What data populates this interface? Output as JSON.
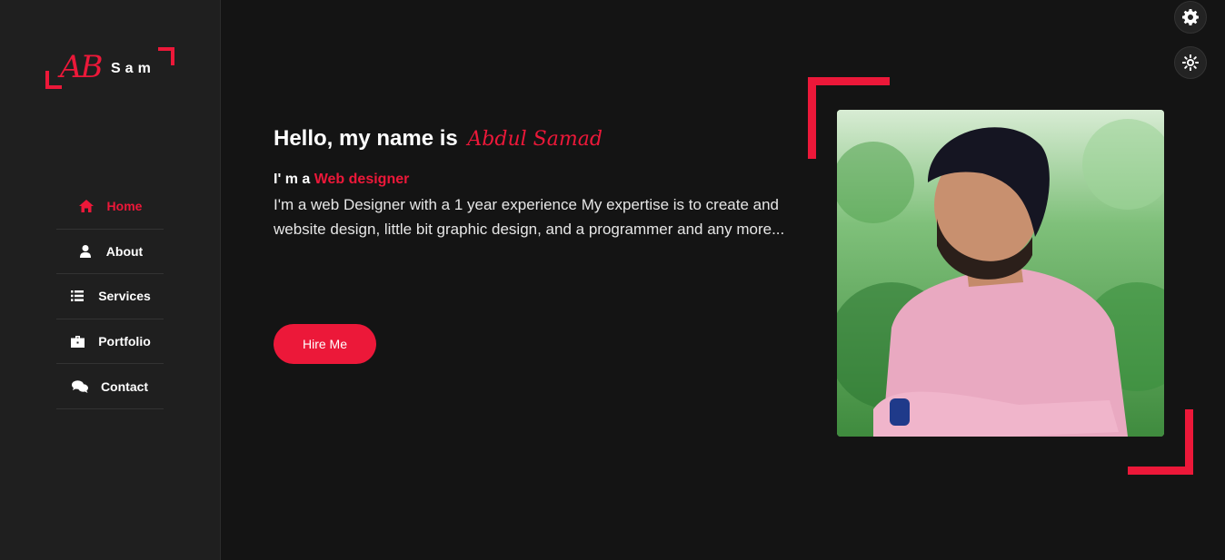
{
  "logo": {
    "mark": "AB",
    "name": "Sam"
  },
  "nav": {
    "items": [
      {
        "label": "Home",
        "icon": "home-icon",
        "active": true
      },
      {
        "label": "About",
        "icon": "user-icon",
        "active": false
      },
      {
        "label": "Services",
        "icon": "list-icon",
        "active": false
      },
      {
        "label": "Portfolio",
        "icon": "briefcase-icon",
        "active": false
      },
      {
        "label": "Contact",
        "icon": "comments-icon",
        "active": false
      }
    ]
  },
  "hero": {
    "greeting": "Hello, my name is",
    "name": "Abdul Samad",
    "role_prefix": "I' m a",
    "role": "Web designer",
    "description": "I'm a web Designer with a 1 year experience My expertise is to create and website design, little bit graphic design, and a programmer and any more...",
    "cta": "Hire Me"
  },
  "controls": {
    "settings_icon": "gear-icon",
    "theme_icon": "sun-icon"
  },
  "colors": {
    "accent": "#ec1839",
    "background": "#141414",
    "sidebar": "#1f1f1f"
  }
}
